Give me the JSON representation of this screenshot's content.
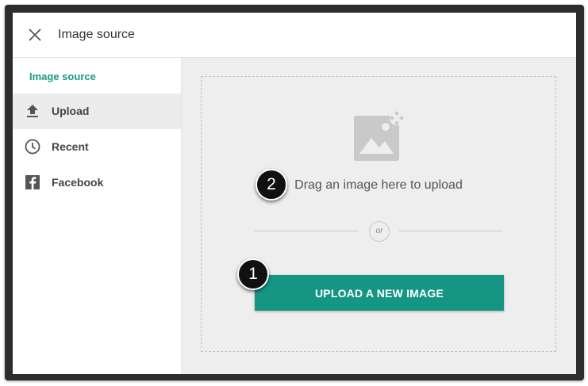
{
  "dialog": {
    "title": "Image source",
    "close_icon": "close-icon"
  },
  "sidebar": {
    "heading": "Image source",
    "items": [
      {
        "label": "Upload",
        "icon": "upload-icon",
        "active": true
      },
      {
        "label": "Recent",
        "icon": "clock-icon",
        "active": false
      },
      {
        "label": "Facebook",
        "icon": "facebook-icon",
        "active": false
      }
    ]
  },
  "main": {
    "placeholder_icon": "image-placeholder-icon",
    "drag_text": "Drag an image here to upload",
    "or_text": "or",
    "upload_button": "UPLOAD A NEW IMAGE"
  },
  "annotations": {
    "badge_1": "1",
    "badge_2": "2"
  },
  "colors": {
    "accent": "#159685",
    "heading": "#1a9a8a",
    "frame": "#2d2d2d",
    "main_bg": "#eeeeee"
  }
}
